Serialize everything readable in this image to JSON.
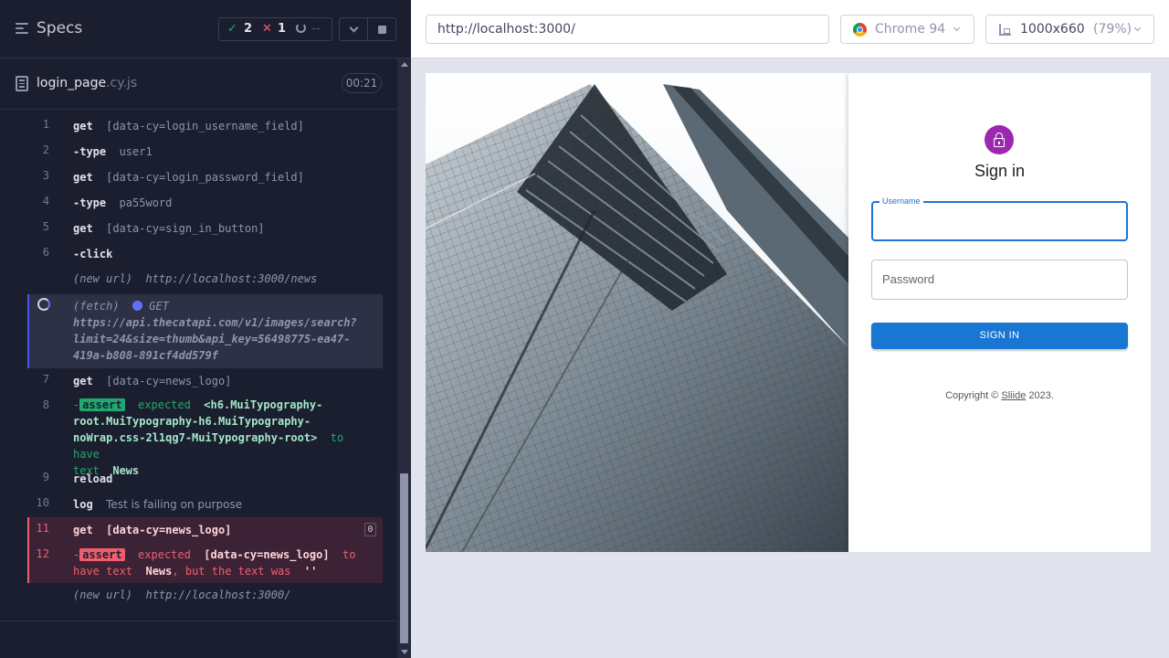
{
  "reporter": {
    "specs_title": "Specs",
    "stats": {
      "passed": "2",
      "failed": "1",
      "pending": "--",
      "pass_icon": "✓",
      "fail_icon": "✕"
    },
    "file": {
      "name": "login_page",
      "ext": ".cy.js"
    },
    "timer": "00:21",
    "commands": [
      {
        "num": "1",
        "name": "get",
        "arg": "[data-cy=login_username_field]"
      },
      {
        "num": "2",
        "name": "-type",
        "arg": "user1"
      },
      {
        "num": "3",
        "name": "get",
        "arg": "[data-cy=login_password_field]"
      },
      {
        "num": "4",
        "name": "-type",
        "arg": "pa55word"
      },
      {
        "num": "5",
        "name": "get",
        "arg": "[data-cy=sign_in_button]"
      },
      {
        "num": "6",
        "name": "-click",
        "arg": ""
      }
    ],
    "new_url_1": {
      "label": "(new url)",
      "url": "http://localhost:3000/news"
    },
    "fetch": {
      "label": "(fetch)",
      "method": "GET",
      "url_line1": "https://api.thecatapi.com/v1/images/search?",
      "url_line2": "limit=24&size=thumb&api_key=56498775-ea47-",
      "url_line3": "419a-b808-891cf4dd579f"
    },
    "cmd7": {
      "num": "7",
      "name": "get",
      "arg": "[data-cy=news_logo]"
    },
    "cmd8": {
      "num": "8",
      "dash": "-",
      "badge": "assert",
      "expected": "expected",
      "el_line1": "<h6.MuiTypography-",
      "el_line2": "root.MuiTypography-h6.MuiTypography-",
      "el_line3": "noWrap.css-2l1qg7-MuiTypography-root>",
      "to_have": "to have",
      "text_word": "text",
      "value": "News"
    },
    "cmd9": {
      "num": "9",
      "name": "reload"
    },
    "cmd10": {
      "num": "10",
      "name": "log",
      "arg": "Test is failing on purpose"
    },
    "cmd11": {
      "num": "11",
      "name": "get",
      "arg": "[data-cy=news_logo]",
      "count": "0"
    },
    "cmd12": {
      "num": "12",
      "dash": "-",
      "badge": "assert",
      "expected": "expected",
      "selector": "[data-cy=news_logo]",
      "to": "to",
      "have_text": "have text",
      "value": "News",
      "but": ", but the text was",
      "actual": "''"
    },
    "new_url_2": {
      "label": "(new url)",
      "url": "http://localhost:3000/"
    }
  },
  "preview": {
    "url": "http://localhost:3000/",
    "browser": "Chrome 94",
    "viewport_size": "1000x660",
    "viewport_zoom": "(79%)"
  },
  "app": {
    "title": "Sign in",
    "username_label": "Username",
    "password_placeholder": "Password",
    "signin_button": "SIGN IN",
    "copyright_prefix": "Copyright ©",
    "copyright_link": "Sliide",
    "copyright_suffix": "2023."
  },
  "colors": {
    "reporter_bg": "#1b1e2e",
    "pass": "#1fa971",
    "fail": "#f15e6e",
    "accent": "#1976d2",
    "avatar": "#9c27b0"
  }
}
